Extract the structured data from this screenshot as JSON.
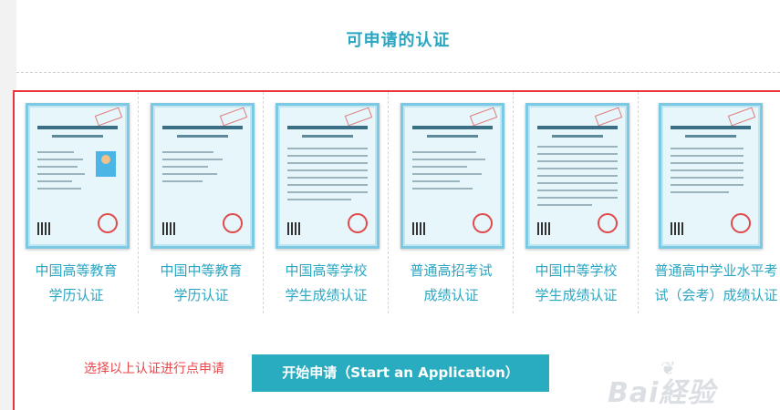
{
  "header": {
    "title": "可申请的认证"
  },
  "certificates": [
    {
      "line1": "中国高等教育",
      "line2": "学历认证",
      "has_photo": true
    },
    {
      "line1": "中国中等教育",
      "line2": "学历认证",
      "has_photo": false
    },
    {
      "line1": "中国高等学校",
      "line2": "学生成绩认证",
      "has_photo": false
    },
    {
      "line1": "普通高招考试",
      "line2": "成绩认证",
      "has_photo": false
    },
    {
      "line1": "中国中等学校",
      "line2": "学生成绩认证",
      "has_photo": false
    },
    {
      "line1": "普通高中学业水平考",
      "line2": "试（会考）成绩认证",
      "has_photo": false
    }
  ],
  "actions": {
    "hint": "选择以上认证进行点申请",
    "start_button": "开始申请（Start an Application）"
  },
  "watermark": {
    "text": "Bai経验"
  },
  "colors": {
    "accent": "#2aa6c2",
    "button": "#2aacc0",
    "highlight_border": "#e8343a",
    "hint": "#e8474c"
  }
}
